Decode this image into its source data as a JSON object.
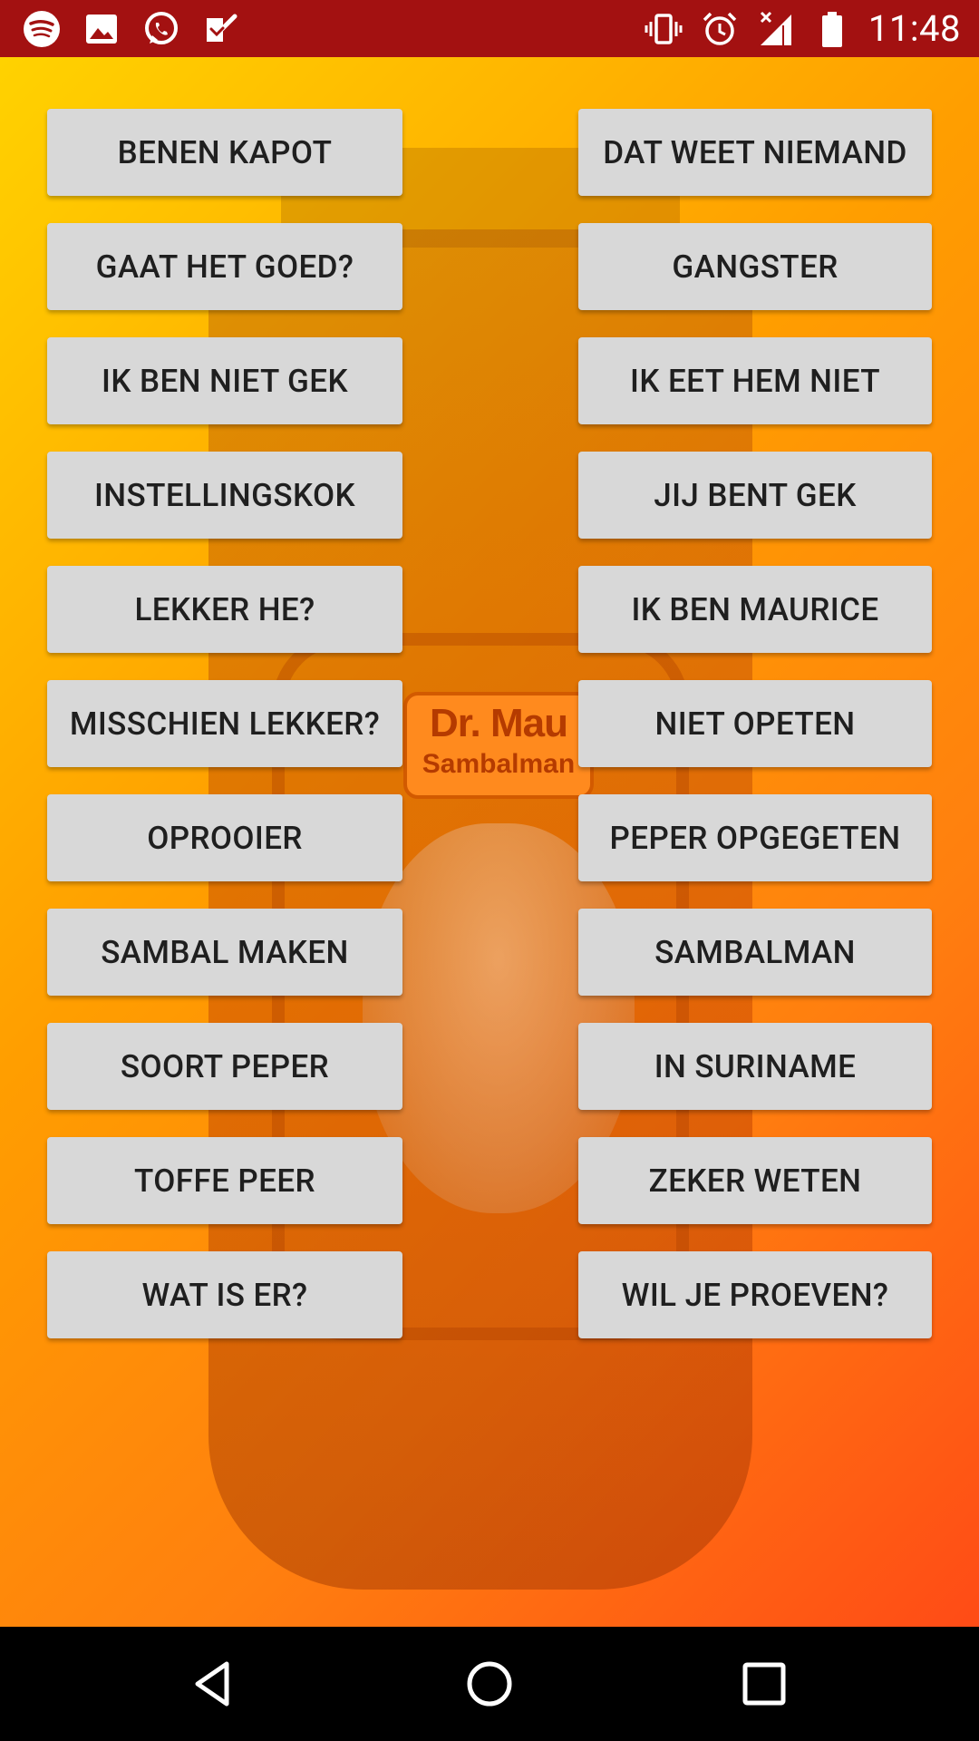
{
  "status_bar": {
    "time": "11:48",
    "left_icons": [
      "spotify-icon",
      "image-icon",
      "whatsapp-icon",
      "task-check-icon"
    ],
    "right_icons": [
      "vibrate-icon",
      "alarm-icon",
      "signal-no-data-icon",
      "battery-icon"
    ]
  },
  "background": {
    "label_line1": "Dr. Mau",
    "label_line2": "Sambalman"
  },
  "buttons": {
    "left": [
      "BENEN KAPOT",
      "GAAT HET GOED?",
      "IK BEN NIET GEK",
      "INSTELLINGSKOK",
      "LEKKER HE?",
      "MISSCHIEN LEKKER?",
      "OPROOIER",
      "SAMBAL MAKEN",
      "SOORT PEPER",
      "TOFFE PEER",
      "WAT IS ER?"
    ],
    "right": [
      "DAT WEET NIEMAND",
      "GANGSTER",
      "IK EET HEM NIET",
      "JIJ BENT GEK",
      "IK BEN MAURICE",
      "NIET OPETEN",
      "PEPER OPGEGETEN",
      "SAMBALMAN",
      "IN SURINAME",
      "ZEKER WETEN",
      "WIL JE PROEVEN?"
    ]
  },
  "nav_bar": {
    "icons": [
      "back-icon",
      "home-icon",
      "recents-icon"
    ]
  },
  "colors": {
    "status_bar": "#A31111",
    "button_bg": "#D8D8D8",
    "button_text": "#1F1F1F",
    "gradient_start": "#FFD200",
    "gradient_end": "#FF4B16",
    "nav_bar": "#000000"
  }
}
